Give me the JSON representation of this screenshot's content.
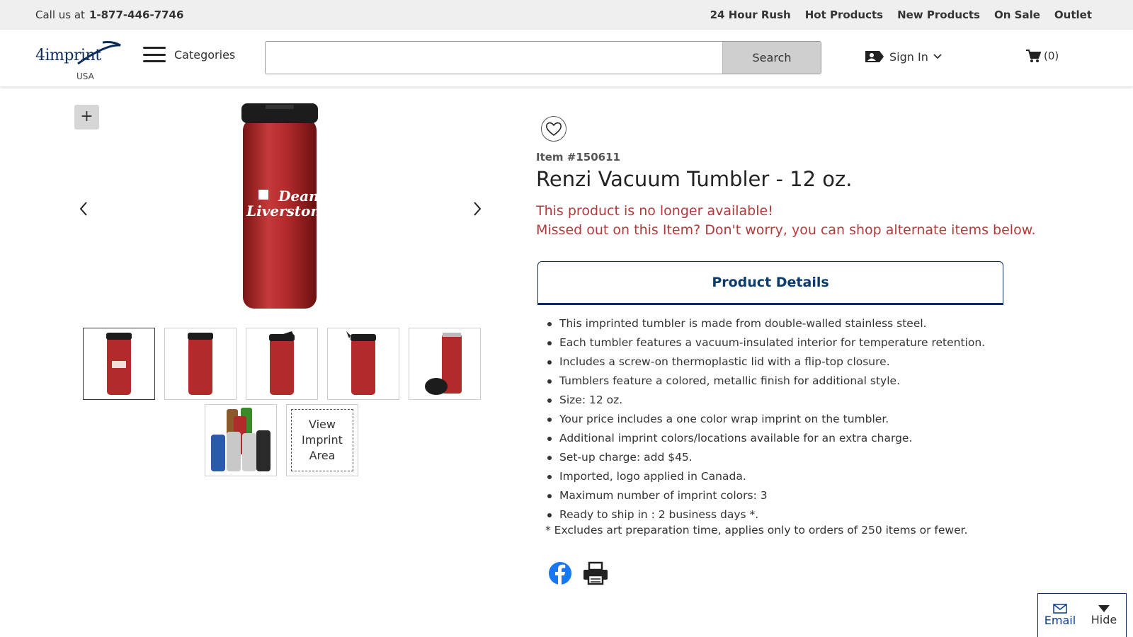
{
  "topbar": {
    "call_label": "Call us at",
    "phone": "1-877-446-7746",
    "links": [
      "24 Hour Rush",
      "Hot Products",
      "New Products",
      "On Sale",
      "Outlet"
    ]
  },
  "header": {
    "logo_brand": "4imprint",
    "logo_country": "USA",
    "categories_label": "Categories",
    "search_value": "",
    "search_button": "Search",
    "signin_label": "Sign In",
    "cart_label": "(0)"
  },
  "gallery": {
    "zoom_label": "+",
    "main_logo_line1": "Dean",
    "main_logo_line2": "Liverston",
    "view_imprint_label": "View Imprint Area"
  },
  "product": {
    "item_number": "Item #150611",
    "title": "Renzi Vacuum Tumbler - 12 oz.",
    "alert_line1": "This product is no longer available!",
    "alert_line2": "Missed out on this Item? Don't worry, you can shop alternate items below.",
    "tab_label": "Product Details",
    "details": [
      "This imprinted tumbler is made from double-walled stainless steel.",
      "Each tumbler features a vacuum-insulated interior for temperature retention.",
      "Includes a screw-on thermoplastic lid with a flip-top closure.",
      "Tumblers feature a colored, metallic finish for additional style.",
      "Size: 12 oz.",
      "Your price includes a one color wrap imprint on the tumbler.",
      "Additional imprint colors/locations available for an extra charge.",
      "Set-up charge: add $45.",
      "Imported, logo applied in Canada.",
      "Maximum number of imprint colors: 3",
      "Ready to ship in : 2 business days *."
    ],
    "footnote": "* Excludes art preparation time, applies only to orders of 250 items or fewer."
  },
  "widget": {
    "email_label": "Email",
    "hide_label": "Hide"
  },
  "colors": {
    "alert": "#b33a3a",
    "brand_navy": "#0c2c5a",
    "tumbler_red": "#b22a2a",
    "facebook": "#1877f2"
  }
}
